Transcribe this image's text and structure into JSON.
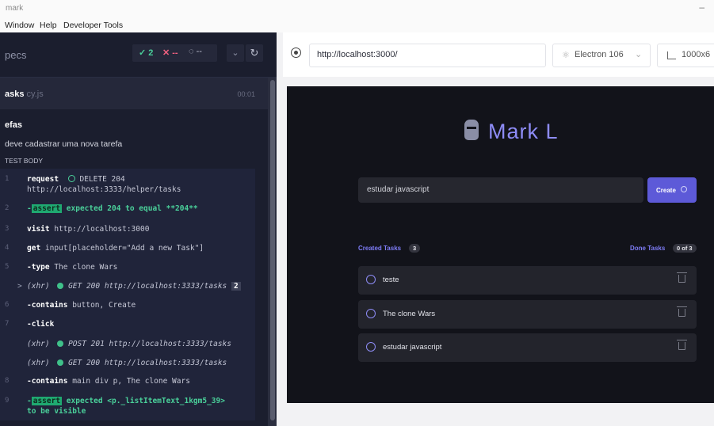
{
  "window": {
    "title": "mark",
    "minimize": "–"
  },
  "menu": [
    "Window",
    "Help",
    "Developer Tools"
  ],
  "reporter": {
    "title": "pecs",
    "passed": "✓ 2",
    "failed": "✕ --",
    "running": "◌ --",
    "chevron": "⌄",
    "reload": "↻",
    "file_name": "asks",
    "file_ext": " cy.js",
    "duration": "00:01",
    "suite": "efas",
    "test": "deve cadastrar uma nova tarefa",
    "body_label": "TEST BODY"
  },
  "commands": [
    {
      "num": "1",
      "name": "request",
      "text": " DELETE 204",
      "line2": "http://localhost:3333/helper/tasks"
    },
    {
      "num": "2",
      "prefix": "-",
      "tag": "assert",
      "text": " expected 204 to equal **204**"
    },
    {
      "num": "3",
      "name": "visit",
      "text": " http://localhost:3000"
    },
    {
      "num": "4",
      "name": "get",
      "text": " input[placeholder=\"Add a new Task\"]"
    },
    {
      "num": "5",
      "name": "-type",
      "text": " The clone Wars"
    },
    {
      "caret": ">",
      "label": "(xhr)",
      "text": "GET 200 http://localhost:3333/tasks",
      "count": "2"
    },
    {
      "num": "6",
      "name": "-contains",
      "text": " button, Create"
    },
    {
      "num": "7",
      "name": "-click"
    },
    {
      "label": "(xhr)",
      "text": "POST 201 http://localhost:3333/tasks"
    },
    {
      "label": "(xhr)",
      "text": "GET 200 http://localhost:3333/tasks"
    },
    {
      "num": "8",
      "name": "-contains",
      "text": " main div p, The clone Wars"
    },
    {
      "num": "9",
      "prefix": "-",
      "tag": "assert",
      "text": " expected <p._listItemText_1kgm5_39>",
      "line2": "to be visible"
    }
  ],
  "browser": {
    "url": "http://localhost:3000/",
    "engine": "Electron 106",
    "viewport": "1000x6"
  },
  "app": {
    "logo": "Mark L",
    "input_value": "estudar javascript",
    "create_label": "Create",
    "created_label": "Created Tasks",
    "created_count": "3",
    "done_label": "Done Tasks",
    "done_count": "0 of 3",
    "tasks": [
      "teste",
      "The clone Wars",
      "estudar javascript"
    ]
  }
}
